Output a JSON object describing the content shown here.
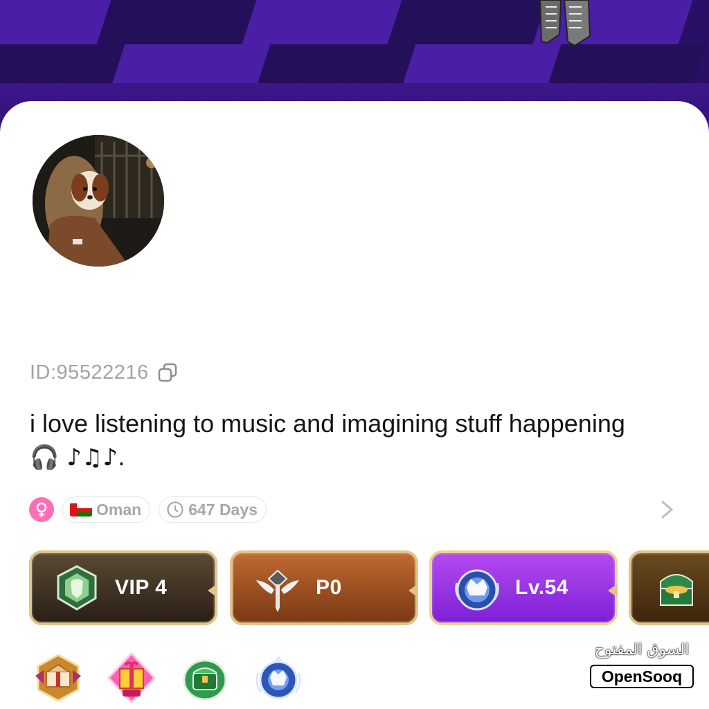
{
  "profile": {
    "id_label": "ID:95522216",
    "bio_text": "i love listening to music and imagining stuff happening",
    "bio_emoji": "🎧 ♪♫♪.",
    "gender": "female",
    "country": "Oman",
    "days": "647 Days"
  },
  "badges": [
    {
      "label": "VIP 4",
      "icon": "lion-emblem"
    },
    {
      "label": "P0",
      "icon": "winged-sword-emblem"
    },
    {
      "label": "Lv.54",
      "icon": "crown-emblem"
    },
    {
      "label": "",
      "icon": "treasure-chest-emblem"
    }
  ],
  "medals": [
    "gift-box-medal",
    "gift-medal",
    "green-chest-medal",
    "blue-crown-medal"
  ],
  "watermark": {
    "arabic": "السوق المفتوح",
    "english": "OpenSooq"
  },
  "colors": {
    "banner": "#2a0f66",
    "gender_badge": "#ff6fb5",
    "vip": "#3a2c1e",
    "p0": "#9c4e22",
    "level": "#9533e6"
  }
}
